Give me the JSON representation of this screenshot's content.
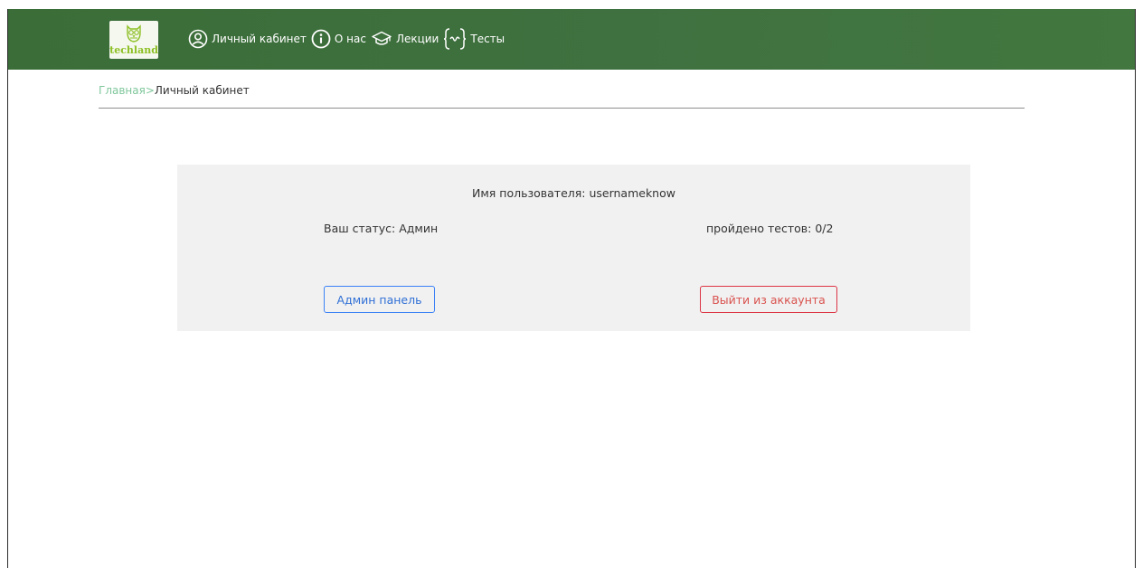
{
  "logo": {
    "text": "techland"
  },
  "nav": {
    "items": [
      {
        "label": "Личный кабинет",
        "icon": "user-circle-icon"
      },
      {
        "label": "О нас",
        "icon": "info-circle-icon"
      },
      {
        "label": "Лекции",
        "icon": "graduation-cap-icon"
      },
      {
        "label": "Тесты",
        "icon": "curly-braces-icon"
      }
    ]
  },
  "breadcrumb": {
    "home": "Главная",
    "separator": ">",
    "current": "Личный кабинет"
  },
  "profile": {
    "username": "Имя пользователя: usernameknow",
    "status": "Ваш статус: Админ",
    "tests_passed": "пройдено тестов: 0/2",
    "admin_button": "Админ панель",
    "logout_button": "Выйти из аккаунта"
  },
  "colors": {
    "navbar": "#3f7140",
    "card_background": "#f1f1f1",
    "breadcrumb_link": "#7fc79b",
    "admin_button": "#3b82f6",
    "logout_button": "#dc3545"
  }
}
